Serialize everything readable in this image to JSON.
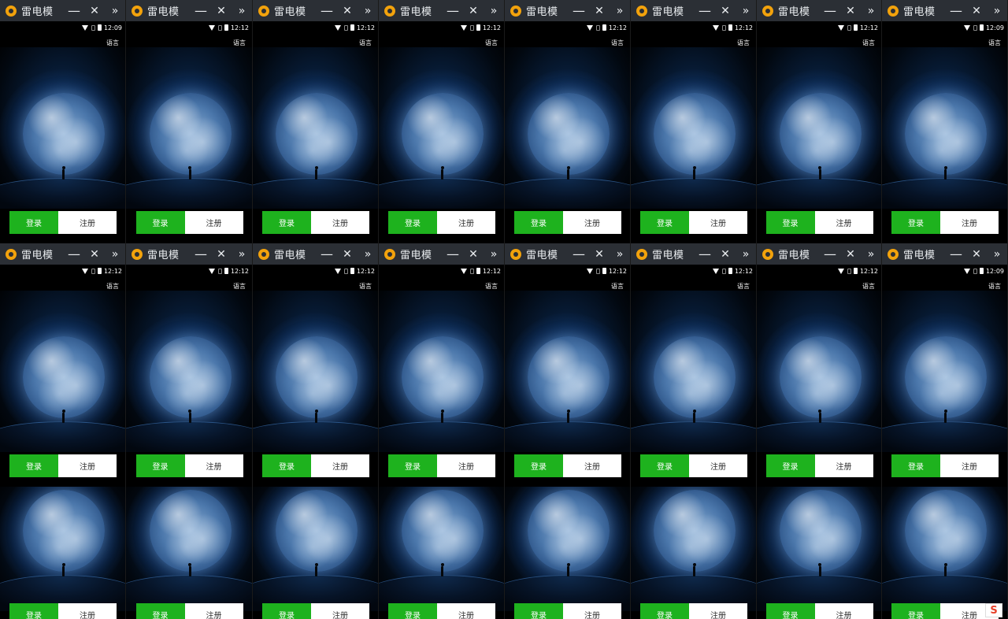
{
  "app": {
    "title": "雷电模",
    "minimize_glyph": "—",
    "close_glyph": "✕",
    "more_glyph": "»"
  },
  "screen": {
    "language_label": "语言",
    "login_label": "登录",
    "register_label": "注册"
  },
  "clock_times": [
    "12:09",
    "12:12",
    "12:12",
    "12:12",
    "12:12",
    "12:12",
    "12:12",
    "12:09",
    "12:12",
    "12:12",
    "12:12",
    "12:12",
    "12:12",
    "12:12",
    "12:12",
    "12:09"
  ],
  "icons": {
    "status": [
      "wifi-icon",
      "sim-icon",
      "battery-icon"
    ],
    "titlebar": [
      "app-logo-icon",
      "minimize-icon",
      "close-icon",
      "more-icon"
    ],
    "corner": "input-method-icon"
  },
  "corner_badge_text": "S",
  "colors": {
    "titlebar_bg": "#2b2f35",
    "logo": "#f2a20c",
    "login_btn": "#1eb21e",
    "register_btn": "#ffffff",
    "background": "#000000"
  }
}
